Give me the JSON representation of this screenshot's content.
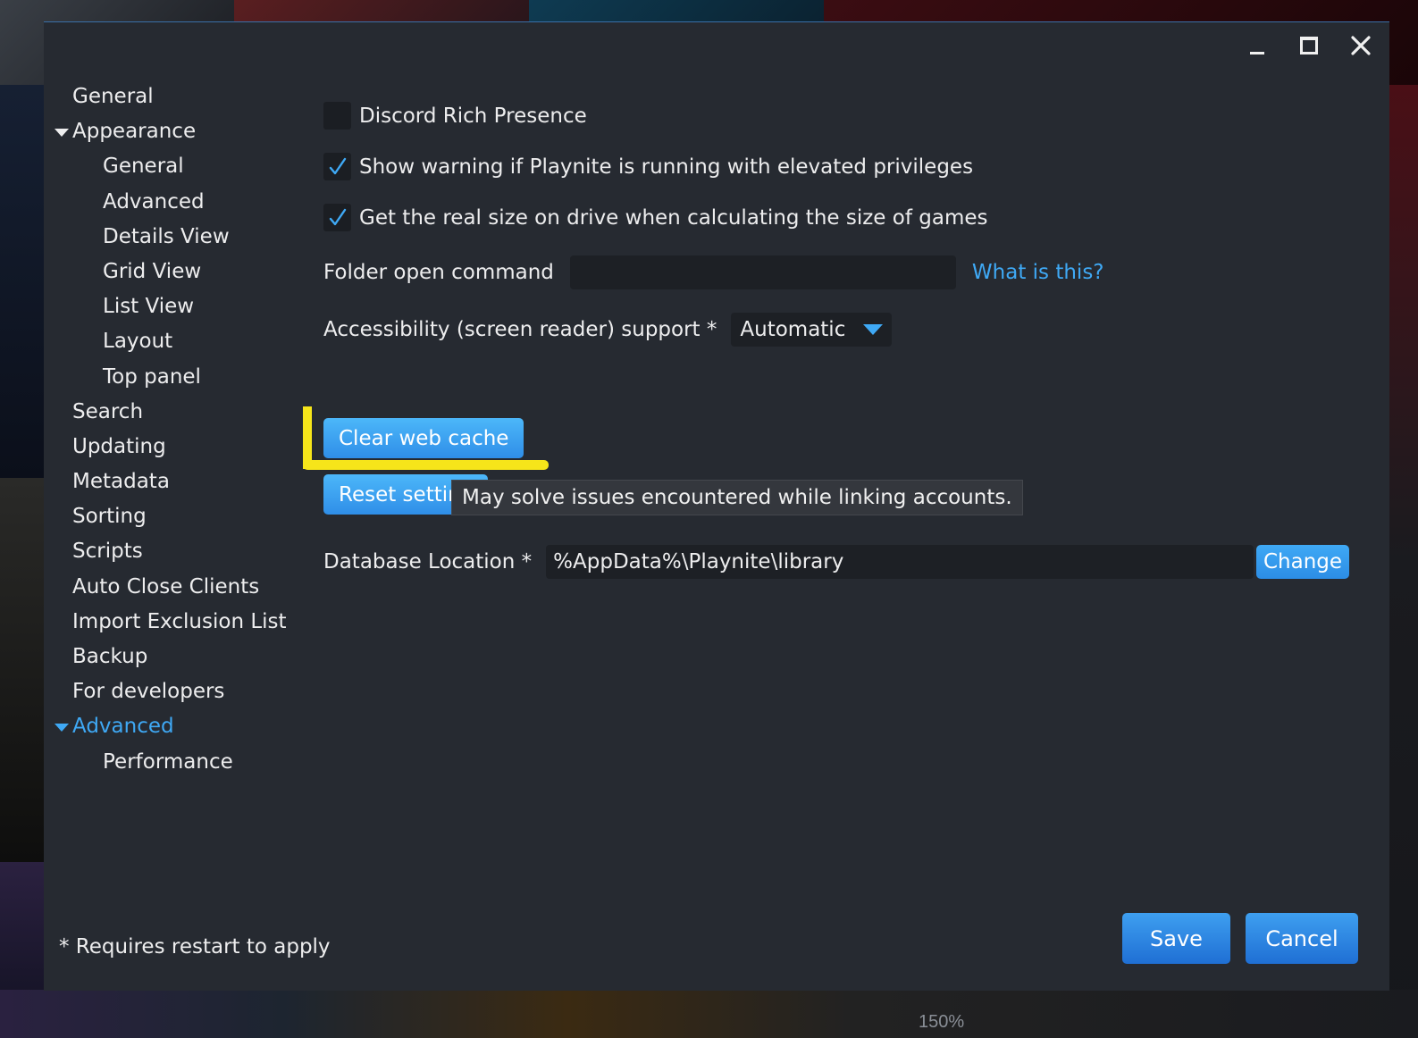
{
  "background": {
    "labels": [
      "150%"
    ]
  },
  "window_controls": {
    "minimize_icon": "minimize-icon",
    "maximize_icon": "maximize-icon",
    "close_icon": "close-icon"
  },
  "sidebar": {
    "items": [
      {
        "label": "General",
        "level": 0
      },
      {
        "label": "Appearance",
        "level": 0,
        "expanded": true
      },
      {
        "label": "General",
        "level": 1
      },
      {
        "label": "Advanced",
        "level": 1
      },
      {
        "label": "Details View",
        "level": 1
      },
      {
        "label": "Grid View",
        "level": 1
      },
      {
        "label": "List View",
        "level": 1
      },
      {
        "label": "Layout",
        "level": 1
      },
      {
        "label": "Top panel",
        "level": 1
      },
      {
        "label": "Search",
        "level": 0
      },
      {
        "label": "Updating",
        "level": 0
      },
      {
        "label": "Metadata",
        "level": 0
      },
      {
        "label": "Sorting",
        "level": 0
      },
      {
        "label": "Scripts",
        "level": 0
      },
      {
        "label": "Auto Close Clients",
        "level": 0
      },
      {
        "label": "Import Exclusion List",
        "level": 0
      },
      {
        "label": "Backup",
        "level": 0
      },
      {
        "label": "For developers",
        "level": 0
      },
      {
        "label": "Advanced",
        "level": 0,
        "expanded": true,
        "active": true
      },
      {
        "label": "Performance",
        "level": 1
      }
    ]
  },
  "settings": {
    "discord_rich_presence": {
      "label": "Discord Rich Presence",
      "checked": false
    },
    "elevated_warning": {
      "label": "Show warning if Playnite is running with elevated privileges",
      "checked": true
    },
    "real_size": {
      "label": "Get the real size on drive when calculating the size of games",
      "checked": true
    },
    "folder_open_command": {
      "label": "Folder open command",
      "value": "",
      "help_link": "What is this?"
    },
    "accessibility": {
      "label": "Accessibility (screen reader) support *",
      "value": "Automatic"
    },
    "clear_web_cache": "Clear web cache",
    "reset_settings": "Reset settings",
    "tooltip": "May solve issues encountered while linking accounts.",
    "database_location": {
      "label": "Database Location *",
      "value": "%AppData%\\Playnite\\library",
      "change_button": "Change"
    }
  },
  "footer": {
    "note": "* Requires restart to apply",
    "save": "Save",
    "cancel": "Cancel"
  },
  "colors": {
    "accent": "#3fa9f5",
    "window_bg": "#262a31",
    "highlight": "#f6e51a"
  }
}
